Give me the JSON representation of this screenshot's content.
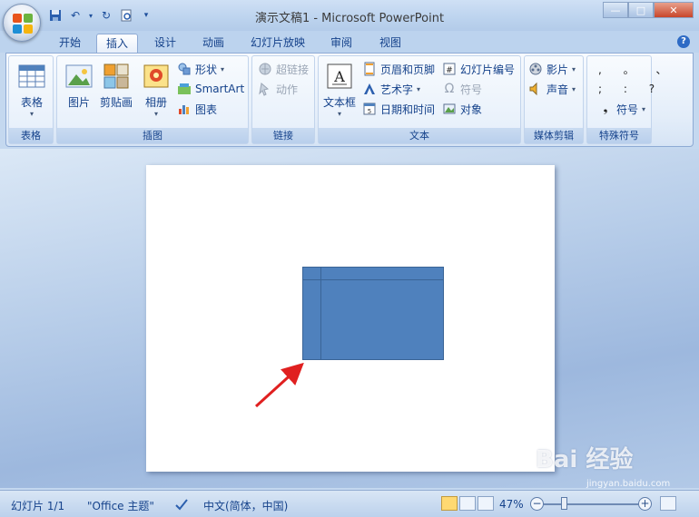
{
  "window": {
    "title": "演示文稿1 - Microsoft PowerPoint",
    "minimize": "—",
    "maximize": "□",
    "close": "✕"
  },
  "tabs": [
    {
      "label": "开始"
    },
    {
      "label": "插入"
    },
    {
      "label": "设计"
    },
    {
      "label": "动画"
    },
    {
      "label": "幻灯片放映"
    },
    {
      "label": "审阅"
    },
    {
      "label": "视图"
    }
  ],
  "active_tab": "插入",
  "help": "?",
  "ribbon": {
    "table_group": {
      "label": "表格",
      "table_button": "表格"
    },
    "illustrations_group": {
      "label": "插图",
      "picture": "图片",
      "clipart": "剪贴画",
      "album": "相册",
      "shapes": "形状",
      "smartart": "SmartArt",
      "chart": "图表"
    },
    "links_group": {
      "label": "链接",
      "hyperlink": "超链接",
      "action": "动作"
    },
    "text_group": {
      "label": "文本",
      "textbox": "文本框",
      "header_footer": "页眉和页脚",
      "wordart": "艺术字",
      "datetime": "日期和时间",
      "slide_number": "幻灯片编号",
      "symbol": "符号",
      "object": "对象"
    },
    "media_group": {
      "label": "媒体剪辑",
      "movie": "影片",
      "sound": "声音"
    },
    "special_group": {
      "label": "特殊符号",
      "symbols_row1": ", 。 、",
      "symbols_row2": "; : ?",
      "symbols_button": "符号"
    }
  },
  "statusbar": {
    "slide": "幻灯片 1/1",
    "theme": "\"Office 主题\"",
    "language": "中文(简体，中国)",
    "zoom": "47%",
    "zoom_minus": "−",
    "zoom_plus": "+"
  },
  "watermark": {
    "text": "Bai 经验",
    "url": "jingyan.baidu.com"
  },
  "colors": {
    "table_fill": "#4f81bd",
    "arrow": "#e02020"
  }
}
